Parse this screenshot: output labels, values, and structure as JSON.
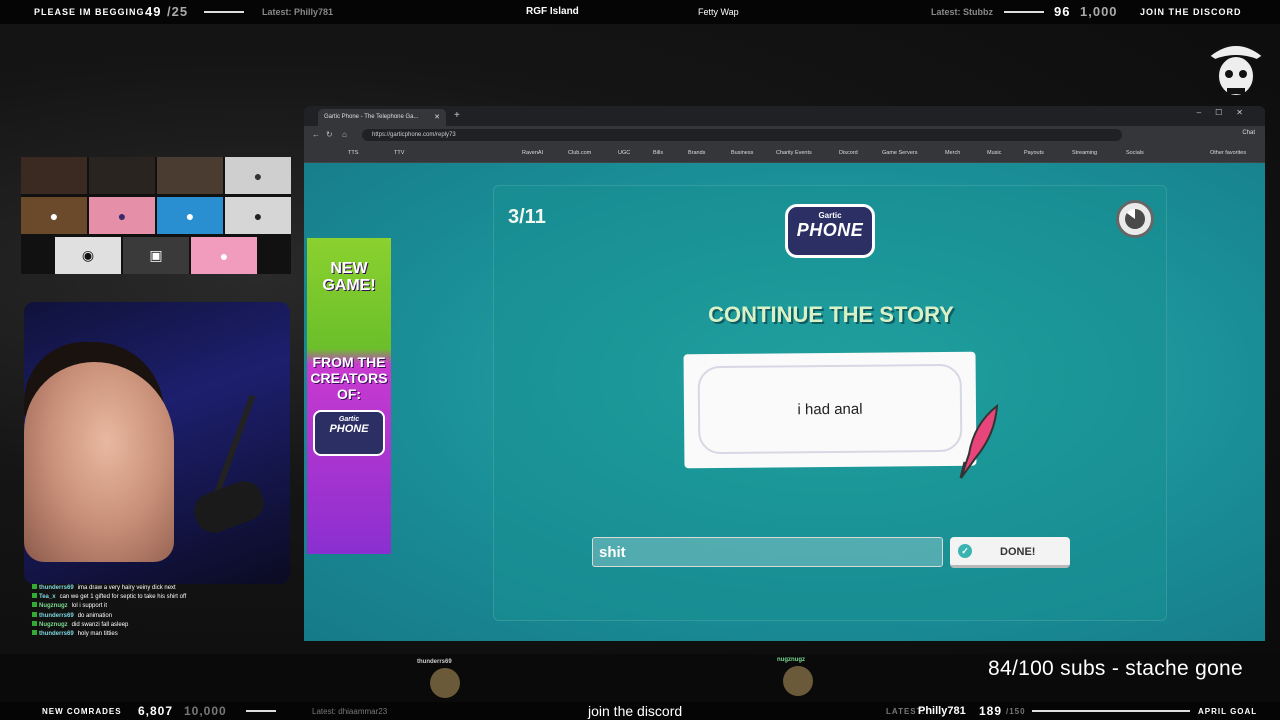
{
  "topbar": {
    "goal_label": "PLEASE IM BEGGING",
    "goal_current": "49",
    "goal_target": "/25",
    "latest_left": "Latest: Philly781",
    "now_playing_title": "RGF Island",
    "now_playing_artist": "Fetty Wap",
    "latest_right": "Latest: Stubbz",
    "right_current": "96",
    "right_target": "1,000",
    "discord_cta": "JOIN THE DISCORD"
  },
  "browser": {
    "tab_title": "Gartic Phone - The Telephone Ga...",
    "url": "https://garticphone.com/reply73",
    "chat_label": "Chat",
    "bookmarks": [
      "TTS",
      "TTV",
      "RavenAI",
      "Club.com",
      "UGC",
      "Bills",
      "Brands",
      "Business",
      "Charity Events",
      "Discord",
      "Game Servers",
      "Merch",
      "Music",
      "Payouts",
      "Streaming",
      "Socials"
    ],
    "other_bookmarks": "Other favorites"
  },
  "game": {
    "round": "3/11",
    "logo_small": "Gartic",
    "logo_big": "PHONE",
    "heading": "CONTINUE THE STORY",
    "prompt_text": "i had anal",
    "input_value": "shit",
    "done_label": "DONE!"
  },
  "ad": {
    "line1": "NEW GAME!",
    "line2": "FROM THE CREATORS OF:",
    "logo_small": "Gartic",
    "logo_big": "PHONE"
  },
  "chat": [
    {
      "user": "thunderrs69",
      "msg": "ima draw a very hairy veiny dick next"
    },
    {
      "user": "Tea_x",
      "msg": "can we get 1 gifted for septic to take his shirt off"
    },
    {
      "user": "Nugznugz",
      "msg": "lol i support it"
    },
    {
      "user": "thunderrs69",
      "msg": "do animation"
    },
    {
      "user": "Nugznugz",
      "msg": "did swanzi fall asleep"
    },
    {
      "user": "thunderrs69",
      "msg": "holy man titties"
    }
  ],
  "overlay": {
    "subs_goal": "84/100 subs - stache gone",
    "viewer_left": "thunderrs69",
    "viewer_right": "nugznugz"
  },
  "bottombar": {
    "comrades_label": "NEW COMRADES",
    "comrades_current": "6,807",
    "comrades_target": "10,000",
    "latest_left": "Latest: dhiaammar23",
    "discord_text": "join the discord",
    "latest_right_label": "LATEST:",
    "latest_right_user": "Philly781",
    "april_current": "189",
    "april_target": "/150",
    "april_label": "APRIL GOAL"
  }
}
